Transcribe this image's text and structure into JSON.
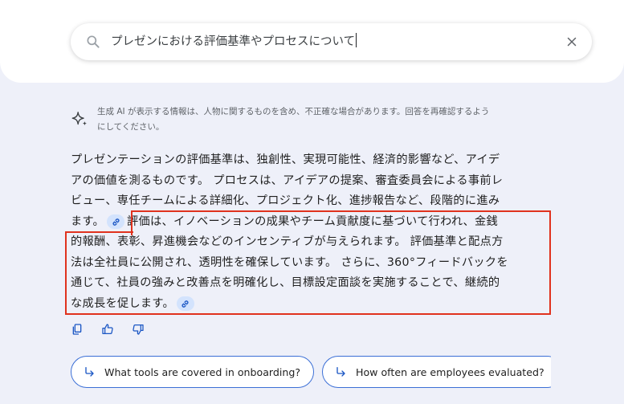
{
  "search": {
    "query": "プレゼンにおける評価基準やプロセスについて"
  },
  "disclaimer": {
    "line1": "生成 AI が表示する情報は、人物に関するものを含め、不正確な場合があります。回答を再確認するよう",
    "line2": "にしてください。"
  },
  "answer": {
    "line1": "プレゼンテーションの評価基準は、独創性、実現可能性、経済的影響など、アイデ",
    "line2": "アの価値を測るものです。 プロセスは、アイデアの提案、審査委員会による事前レ",
    "line3": "ビュー、専任チームによる詳細化、プロジェクト化、進捗報告など、段階的に進み",
    "line4a": "ます。",
    "line4b": "評価は、イノベーションの成果やチーム貢献度に基づいて行われ、金銭",
    "line5": "的報酬、表彰、昇進機会などのインセンティブが与えられます。 評価基準と配点方",
    "line6": "法は全社員に公開され、透明性を確保しています。 さらに、360°フィードバックを",
    "line7": "通じて、社員の強みと改善点を明確化し、目標設定面談を実施することで、継続的",
    "line8": "な成長を促します。"
  },
  "suggestions": [
    {
      "label": "What tools are covered in onboarding?"
    },
    {
      "label": "How often are employees evaluated?"
    }
  ],
  "colors": {
    "accent": "#3b6fd6",
    "highlight": "#e0321e",
    "chip": "#d3e3fd"
  }
}
